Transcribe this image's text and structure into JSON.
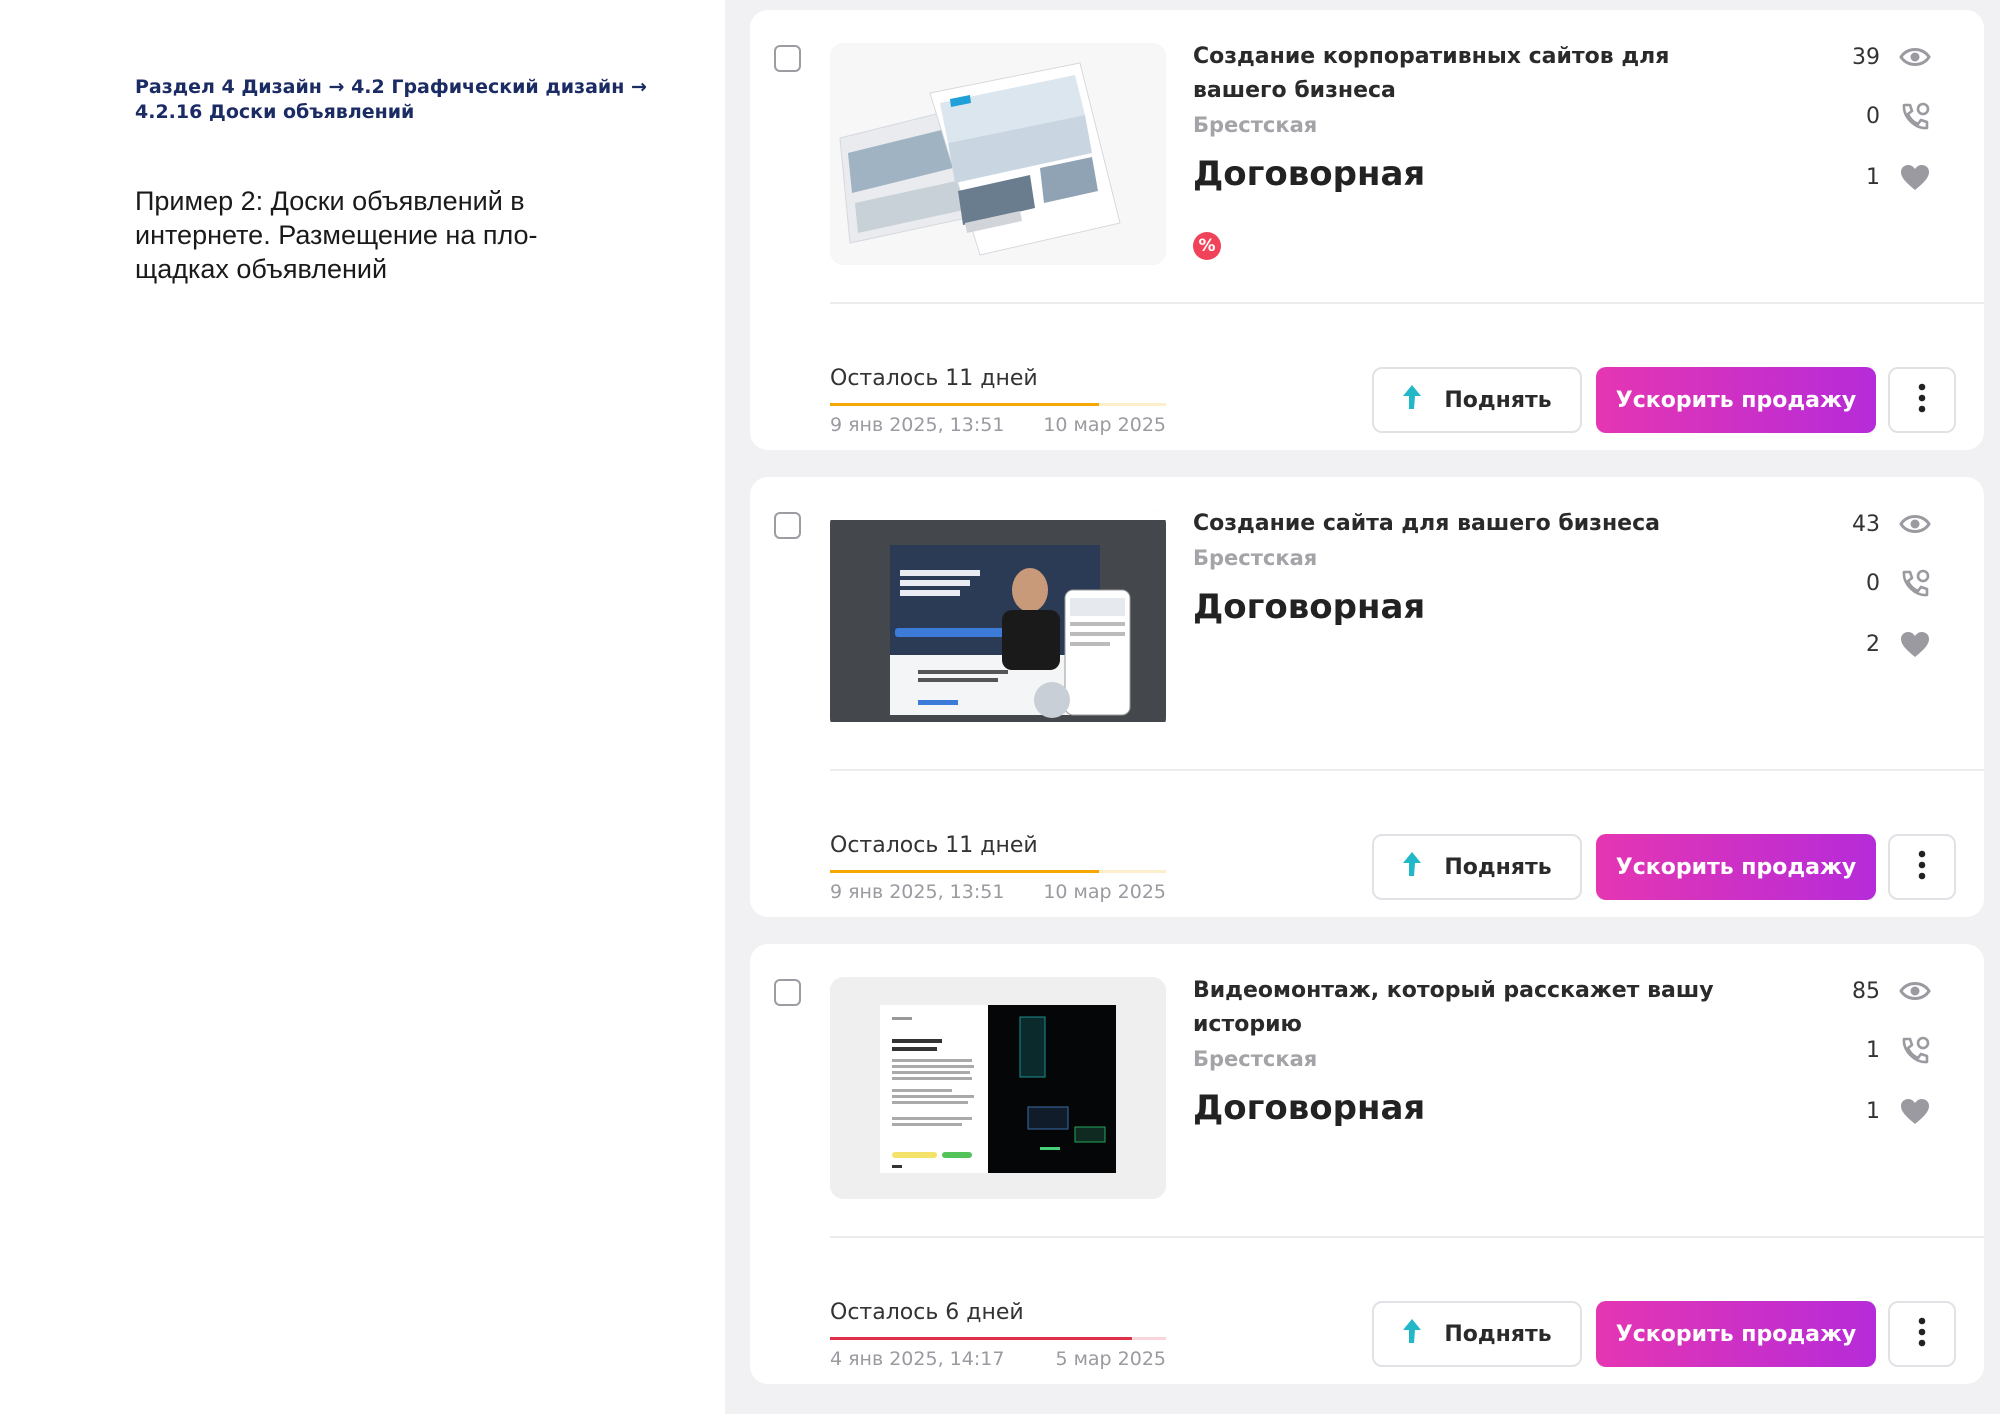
{
  "breadcrumb": "Раздел 4 Дизайн  → 4.2 Графический дизайн → 4.2.16 Доски объявлений",
  "caption": "Пример 2: Доски объявлений в интернете. Размещение на пло-щадках объявлений",
  "buttons": {
    "raise_label": "Поднять",
    "boost_label": "Ускорить продажу"
  },
  "icons": {
    "views": "eye-icon",
    "calls": "phone-call-icon",
    "favorites": "heart-icon",
    "raise": "arrow-up-icon",
    "more": "more-vertical-icon",
    "discount": "percent-icon"
  },
  "colors": {
    "boost_gradient_start": "#e536b2",
    "boost_gradient_end": "#b62bd9",
    "progress_orange": "#f6a800",
    "progress_red": "#e0314b",
    "raise_arrow": "#22b8c8",
    "discount_badge": "#f0435a"
  },
  "listings": [
    {
      "title": "Создание корпоративных сайтов для вашего бизнеса",
      "region": "Брестская",
      "price": "Договорная",
      "discount_symbol": "%",
      "views": "39",
      "calls": "0",
      "favorites": "1",
      "remaining": "Осталось 11 дней",
      "remaining_fraction": 0.8,
      "progress_color": "#f6a800",
      "date_start": "9 янв 2025, 13:51",
      "date_end": "10 мар 2025"
    },
    {
      "title": "Создание сайта для вашего бизнеса",
      "region": "Брестская",
      "price": "Договорная",
      "views": "43",
      "calls": "0",
      "favorites": "2",
      "remaining": "Осталось 11 дней",
      "remaining_fraction": 0.8,
      "progress_color": "#f6a800",
      "date_start": "9 янв 2025, 13:51",
      "date_end": "10 мар 2025"
    },
    {
      "title": "Видеомонтаж, который расскажет вашу историю",
      "region": "Брестская",
      "price": "Договорная",
      "views": "85",
      "calls": "1",
      "favorites": "1",
      "remaining": "Осталось 6 дней",
      "remaining_fraction": 0.9,
      "progress_color": "#e0314b",
      "date_start": "4 янв 2025, 14:17",
      "date_end": "5 мар 2025"
    }
  ]
}
